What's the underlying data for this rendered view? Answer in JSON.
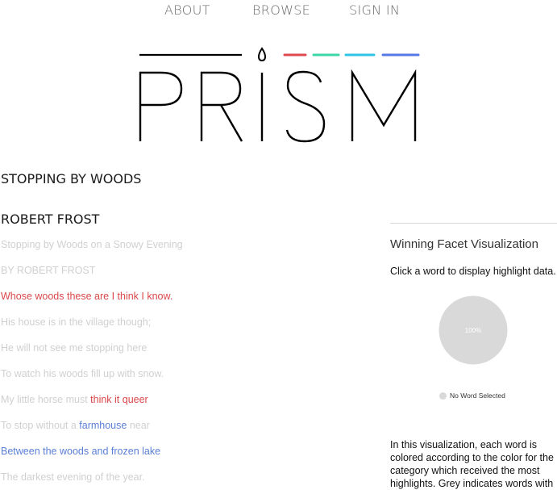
{
  "nav": {
    "about": "ABOUT",
    "browse": "BROWSE",
    "signin": "SIGN IN"
  },
  "logo": {
    "text": "PRISM",
    "bar_colors": [
      "#e0484f",
      "#3dd6a6",
      "#2fc4e6",
      "#5579e4"
    ]
  },
  "work": {
    "title": "STOPPING BY WOODS",
    "author": "ROBERT FROST"
  },
  "poem": {
    "line1": "Stopping by Woods on a Snowy Evening",
    "line2": "BY ROBERT FROST",
    "line3": "Whose woods these are I think I know.",
    "line4": "His house is in the village though;",
    "line5": "He will not see me stopping here",
    "line6": "To watch his woods fill up with snow.",
    "line7a": "My little horse must ",
    "line7b": "think it queer",
    "line8a": "To stop without a ",
    "line8b": "farmhouse",
    "line8c": " near",
    "line9": "Between the woods and frozen lake",
    "line10": "The darkest evening of the year."
  },
  "panel": {
    "title": "Winning Facet Visualization",
    "hint": "Click a word to display highlight data.",
    "pie_label": "100%",
    "pie_fraction": 1,
    "pie_color": "#d9d9d9",
    "legend": "No Word Selected",
    "description": "In this visualization, each word is colored according to the color for the category which received the most highlights. Grey indicates words with"
  },
  "colors": {
    "red": "#d9484a",
    "blue": "#5b7fd6",
    "faded": "#d0d0d0"
  }
}
